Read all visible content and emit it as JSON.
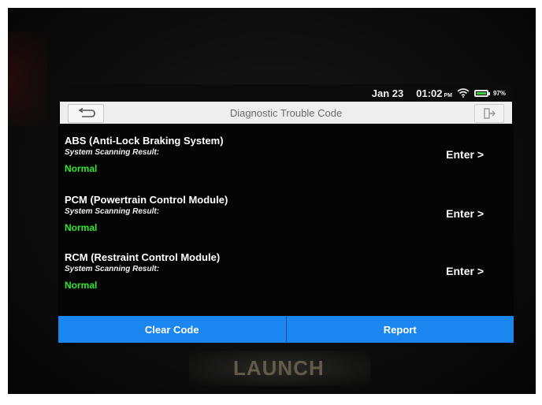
{
  "status_bar": {
    "date": "Jan 23",
    "time": "01:02",
    "ampm": "PM",
    "battery_percent": "97%",
    "battery_level": 0.97,
    "battery_color": "#3ad13a"
  },
  "header": {
    "title": "Diagnostic Trouble Code",
    "back_icon": "back-arrow-icon",
    "exit_icon": "exit-icon"
  },
  "systems": [
    {
      "name": "ABS (Anti-Lock Braking System)",
      "scan_label": "System Scanning Result:",
      "result": "Normal",
      "enter_label": "Enter >"
    },
    {
      "name": "PCM (Powertrain Control Module)",
      "scan_label": "System Scanning Result:",
      "result": "Normal",
      "enter_label": "Enter >"
    },
    {
      "name": "RCM (Restraint Control Module)",
      "scan_label": "System Scanning Result:",
      "result": "Normal",
      "enter_label": "Enter >"
    }
  ],
  "footer": {
    "clear_code_label": "Clear Code",
    "report_label": "Report"
  },
  "device": {
    "brand": "LAUNCH"
  },
  "colors": {
    "accent": "#1b86f0",
    "normal_status": "#2ee82e"
  }
}
